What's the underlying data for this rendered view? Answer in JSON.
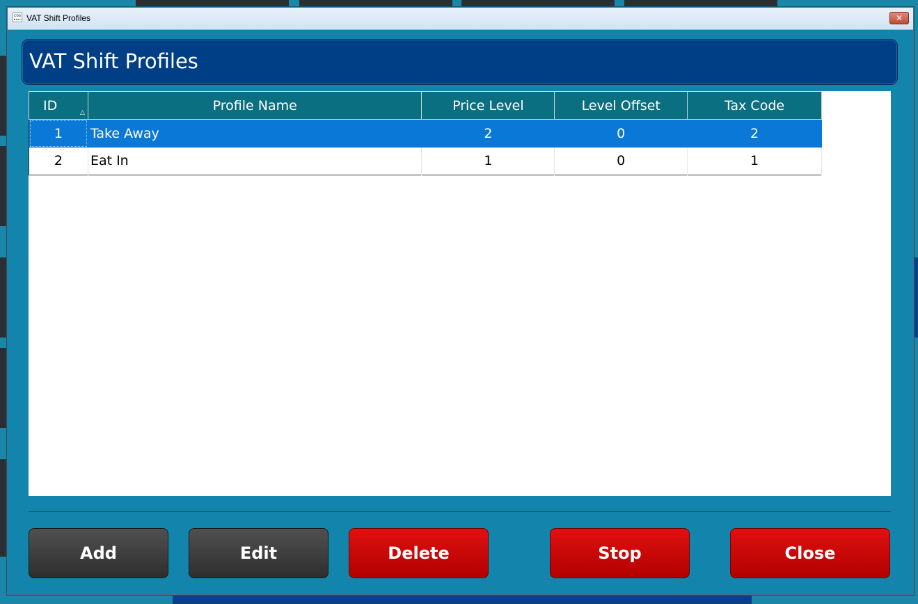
{
  "window": {
    "title": "VAT Shift Profiles",
    "close_glyph": "✕",
    "app_icon_label": "cos"
  },
  "header": {
    "title": "VAT Shift Profiles"
  },
  "grid": {
    "columns": [
      "ID",
      "Profile Name",
      "Price Level",
      "Level Offset",
      "Tax Code"
    ],
    "sort_indicator": "△",
    "rows": [
      {
        "id": "1",
        "name": "Take Away",
        "price_level": "2",
        "level_offset": "0",
        "tax_code": "2",
        "selected": true
      },
      {
        "id": "2",
        "name": "Eat In",
        "price_level": "1",
        "level_offset": "0",
        "tax_code": "1",
        "selected": false
      }
    ]
  },
  "buttons": {
    "add": "Add",
    "edit": "Edit",
    "delete": "Delete",
    "stop": "Stop",
    "close": "Close"
  },
  "colors": {
    "background": "#1384ab",
    "header": "#003f86",
    "grid_header": "#0a6f80",
    "selection": "#0a78d6",
    "button_dark": "#3a3a3a",
    "button_red": "#cc0000"
  }
}
